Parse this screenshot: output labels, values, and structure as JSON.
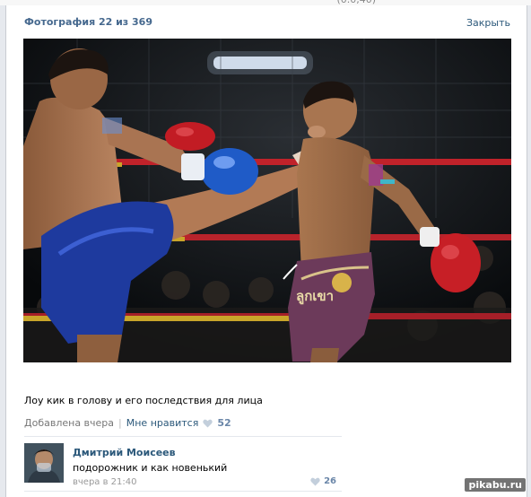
{
  "header": {
    "title": "Фотография 22 из 369",
    "close_label": "Закрыть"
  },
  "photo": {
    "alt": "Muay Thai boys in the ring, high kick to the head",
    "trunks_text": "ลูกเขา"
  },
  "post": {
    "caption": "Лоу кик в голову и его последствия для лица",
    "added_label": "Добавлена вчера",
    "separator": "|",
    "like_label": "Мне нравится",
    "like_count": "52"
  },
  "comment": {
    "author": "Дмитрий Моисеев",
    "text": "подорожник и как новенький",
    "time": "вчера в 21:40",
    "like_count": "26"
  },
  "watermark": "pikabu.ru",
  "colors": {
    "link": "#2b587a",
    "title": "#45688e",
    "heart": "#c3cfdc"
  }
}
